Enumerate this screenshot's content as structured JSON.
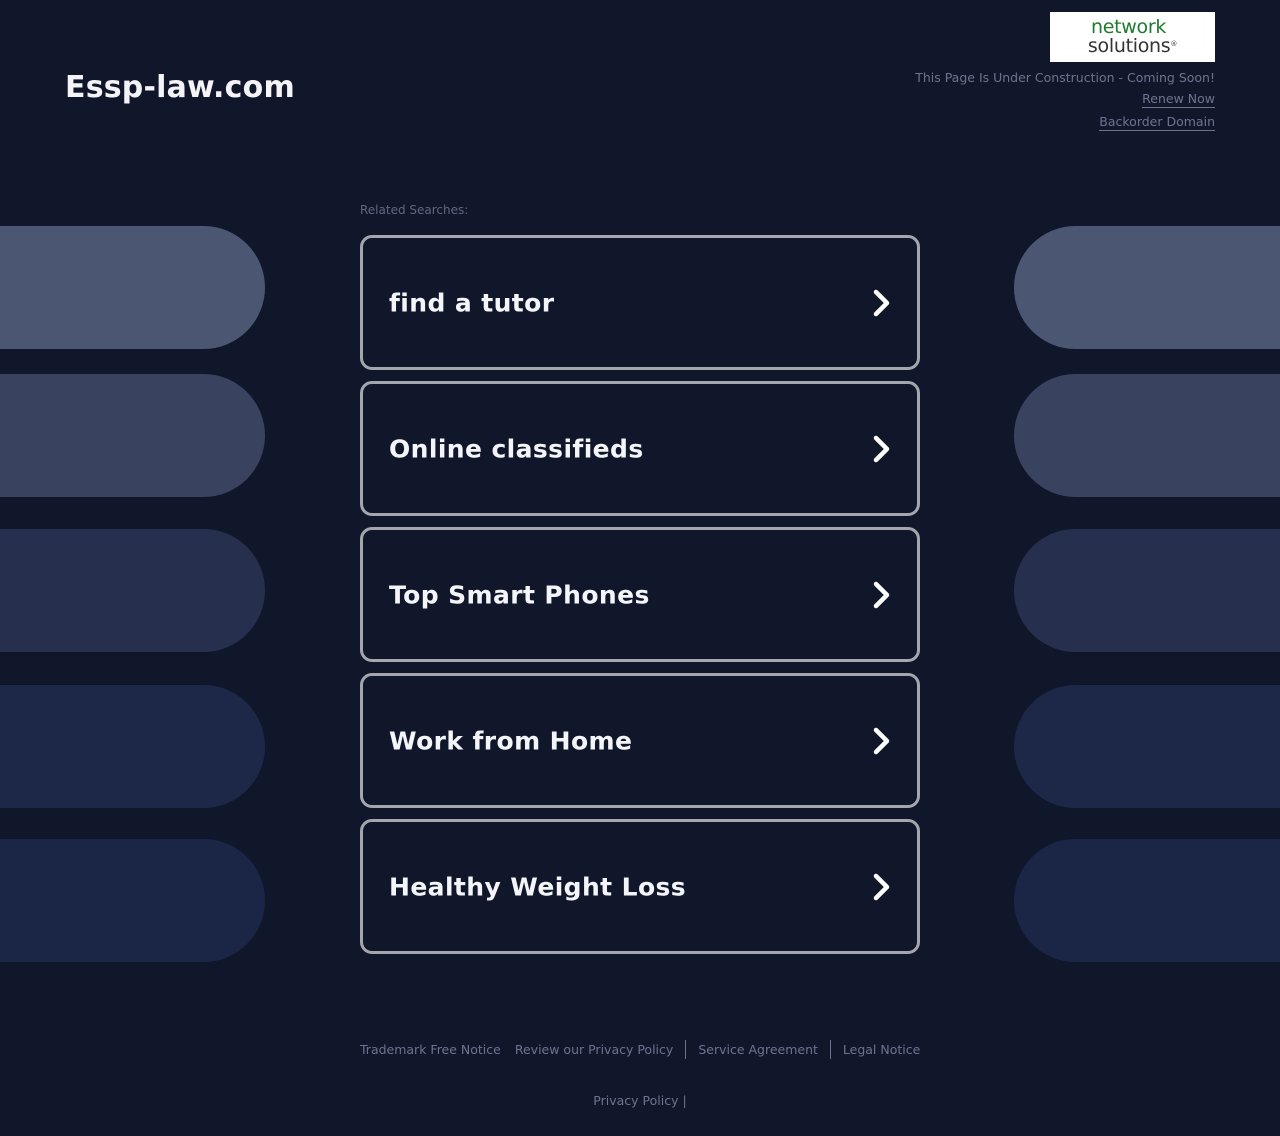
{
  "header": {
    "site_title": "Essp-law.com",
    "logo": {
      "line1": "network",
      "line2": "solutions",
      "mark": "®"
    },
    "notice": "This Page Is Under Construction - Coming Soon!",
    "renew_link": "Renew Now",
    "backorder_link": "Backorder Domain"
  },
  "main": {
    "related_label": "Related Searches:",
    "searches": [
      {
        "label": "find a tutor"
      },
      {
        "label": "Online classifieds"
      },
      {
        "label": "Top Smart Phones"
      },
      {
        "label": "Work from Home"
      },
      {
        "label": "Healthy Weight Loss"
      }
    ]
  },
  "footer": {
    "links": [
      "Trademark Free Notice",
      "Review our Privacy Policy",
      "Service Agreement",
      "Legal Notice"
    ],
    "privacy": "Privacy Policy",
    "privacy_sep": "|"
  },
  "colors": {
    "background": "#11172b",
    "pill_shades": [
      "#4b5672",
      "#39425e",
      "#262f4d",
      "#1d2748",
      "#1b2546"
    ],
    "card_border": "#a4a6ad",
    "muted_text": "#6b7390"
  }
}
